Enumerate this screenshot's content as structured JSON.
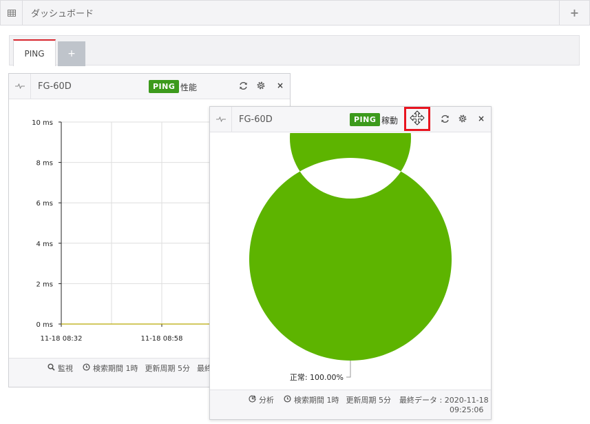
{
  "header": {
    "title": "ダッシュボード",
    "grid_icon": "grid-icon",
    "add_icon": "plus-icon"
  },
  "tabs": [
    {
      "label": "PING",
      "active": true
    },
    {
      "label": "+",
      "active": false
    }
  ],
  "colors": {
    "badge": "#3c9a1c",
    "donut": "#5db400",
    "tab_accent": "#d8262e",
    "highlight": "#e8141f"
  },
  "widget_performance": {
    "device": "FG-60D",
    "badge": "PING",
    "metric": "性能",
    "footer": {
      "monitor_label": "監視",
      "period": "検索期間 1時",
      "interval": "更新周期 5分",
      "last_label": "最終"
    },
    "chart_data": {
      "type": "line",
      "title": "",
      "xlabel": "",
      "ylabel": "",
      "y_ticks": [
        "10 ms",
        "8 ms",
        "6 ms",
        "4 ms",
        "2 ms",
        "0 ms"
      ],
      "y_tick_values": [
        10,
        8,
        6,
        4,
        2,
        0
      ],
      "ylim": [
        0,
        10
      ],
      "x_ticks": [
        "11-18 08:32",
        "11-18 08:58"
      ],
      "series": [
        {
          "values": [
            0,
            0,
            0,
            0,
            0,
            0,
            0
          ]
        }
      ],
      "grid": true
    }
  },
  "widget_uptime": {
    "device": "FG-60D",
    "badge": "PING",
    "metric": "稼動",
    "footer": {
      "analysis_label": "分析",
      "period": "検索期間 1時",
      "interval": "更新周期 5分",
      "last_data": "最終データ : 2020-11-18",
      "last_time": "09:25:06"
    },
    "chart_data": {
      "type": "pie",
      "title": "",
      "slices": [
        {
          "label": "正常",
          "value": 100.0,
          "display": "正常: 100.00%"
        }
      ]
    }
  }
}
